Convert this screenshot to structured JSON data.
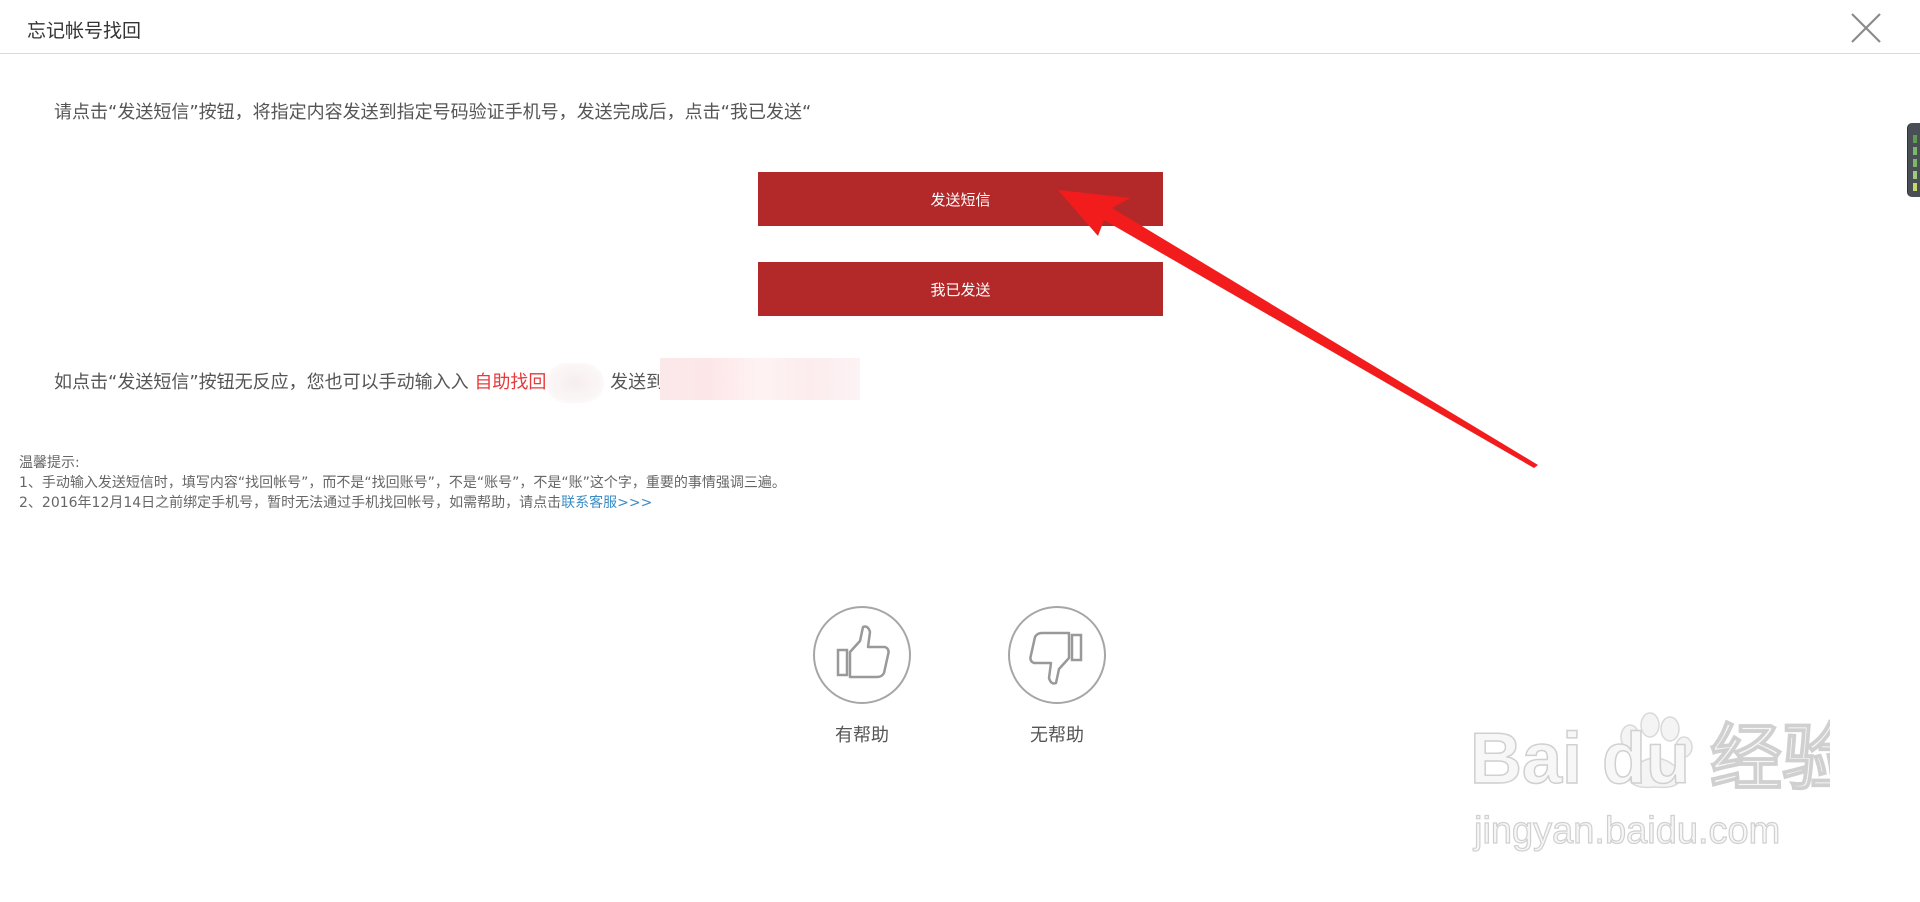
{
  "dialog": {
    "title": "忘记帐号找回",
    "close_icon": "close-icon"
  },
  "instruction": "请点击“发送短信”按钮，将指定内容发送到指定号码验证手机号，发送完成后，点击“我已发送“",
  "buttons": {
    "send_sms": "发送短信",
    "already_sent": "我已发送"
  },
  "manual": {
    "prefix": "如点击“发送短信”按钮无反应，您也可以手动输入入",
    "link": "自助找回",
    "middle": "发送到"
  },
  "tips": {
    "heading": "温馨提示:",
    "line1": "1、手动输入发送短信时，填写内容“找回帐号”，而不是“找回账号”，不是“账号”，不是“账”这个字，重要的事情强调三遍。",
    "line2_prefix": "2、2016年12月14日之前绑定手机号，暂时无法通过手机找回帐号，如需帮助，请点击",
    "line2_link": "联系客服>>>"
  },
  "feedback": {
    "helpful": "有帮助",
    "not_helpful": "无帮助",
    "helpful_icon": "thumbs-up-icon",
    "not_helpful_icon": "thumbs-down-icon"
  },
  "watermark": {
    "brand": "Bai du 经验",
    "url": "jingyan.baidu.com"
  },
  "colors": {
    "button_red": "#b3292a",
    "link_red": "#e8393b",
    "link_blue": "#3b8dc6",
    "arrow_red": "#f21c1c"
  }
}
